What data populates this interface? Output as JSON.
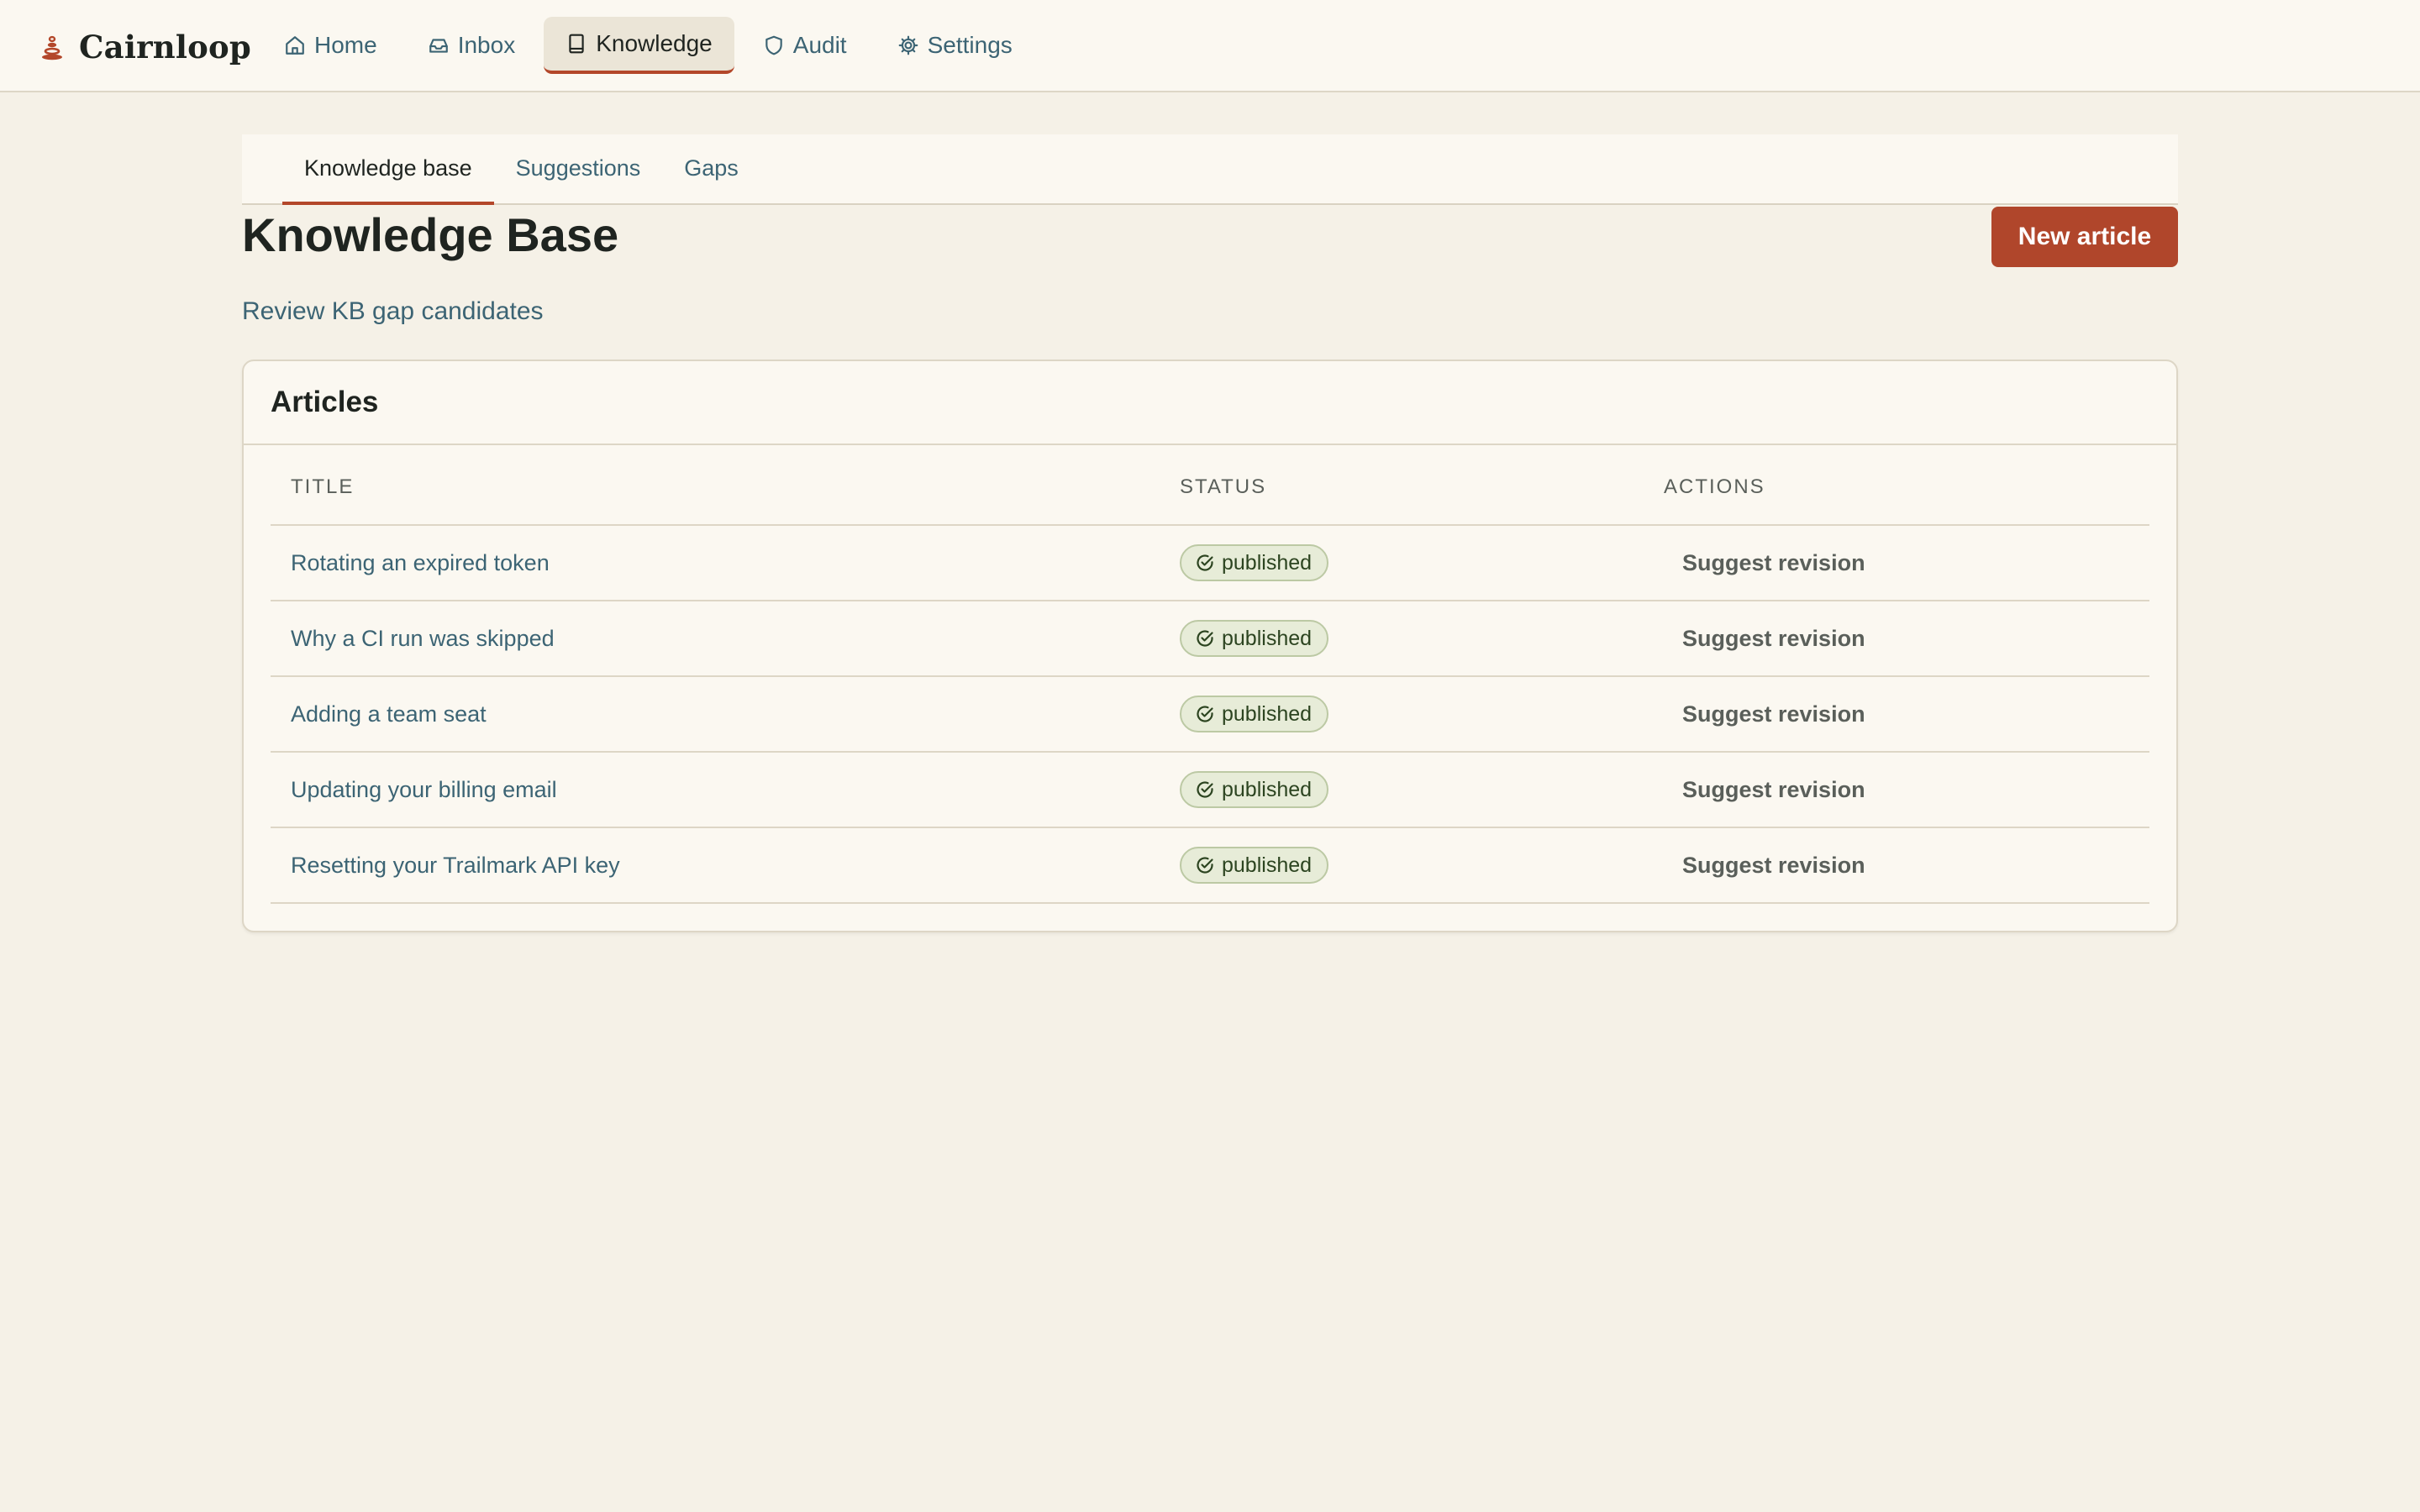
{
  "app": {
    "name": "Cairnloop",
    "logo_icon": "cairn-icon",
    "accent_color": "#b0462b"
  },
  "nav": {
    "items": [
      {
        "label": "Home",
        "icon": "home-icon",
        "active": false
      },
      {
        "label": "Inbox",
        "icon": "inbox-icon",
        "active": false
      },
      {
        "label": "Knowledge",
        "icon": "book-icon",
        "active": true
      },
      {
        "label": "Audit",
        "icon": "shield-icon",
        "active": false
      },
      {
        "label": "Settings",
        "icon": "gear-icon",
        "active": false
      }
    ]
  },
  "subtabs": [
    {
      "label": "Knowledge base",
      "active": true
    },
    {
      "label": "Suggestions",
      "active": false
    },
    {
      "label": "Gaps",
      "active": false
    }
  ],
  "page": {
    "title": "Knowledge Base",
    "new_button": "New article",
    "gap_link": "Review KB gap candidates"
  },
  "articles": {
    "title": "Articles",
    "columns": [
      "TITLE",
      "STATUS",
      "ACTIONS"
    ],
    "rows": [
      {
        "title": "Rotating an expired token",
        "status": "published",
        "action": "Suggest revision"
      },
      {
        "title": "Why a CI run was skipped",
        "status": "published",
        "action": "Suggest revision"
      },
      {
        "title": "Adding a team seat",
        "status": "published",
        "action": "Suggest revision"
      },
      {
        "title": "Updating your billing email",
        "status": "published",
        "action": "Suggest revision"
      },
      {
        "title": "Resetting your Trailmark API key",
        "status": "published",
        "action": "Suggest revision"
      }
    ]
  }
}
